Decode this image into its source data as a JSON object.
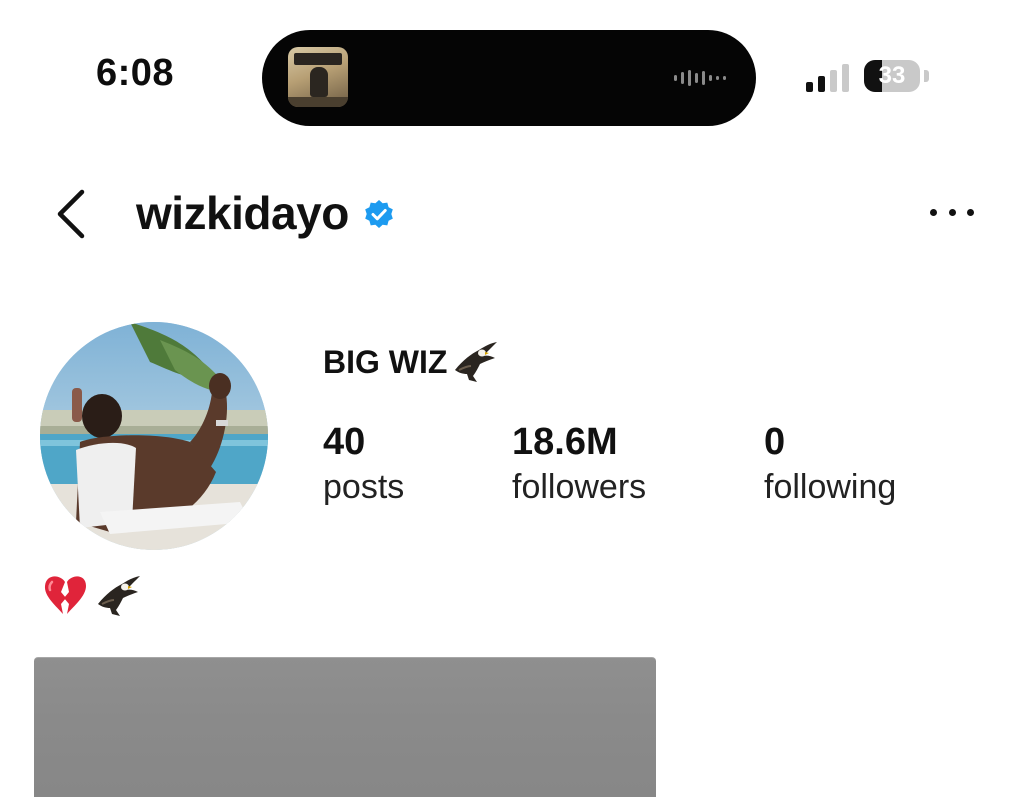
{
  "status_bar": {
    "time": "6:08",
    "battery_level": "33",
    "signal_bars_filled": 2,
    "signal_bars_total": 4
  },
  "now_playing": {
    "art_icon": "album-art-thumbnail",
    "wave_icon": "audio-waveform-icon"
  },
  "header": {
    "username": "wizkidayo",
    "verified": true,
    "back_icon": "chevron-left-icon",
    "more_icon": "more-horizontal-icon"
  },
  "profile": {
    "display_name": "BIG WIZ",
    "display_name_emoji": "eagle-icon",
    "stats": [
      {
        "value": "40",
        "label": "posts"
      },
      {
        "value": "18.6M",
        "label": "followers"
      },
      {
        "value": "0",
        "label": "following"
      }
    ],
    "bio_emojis": [
      "broken-heart-icon",
      "eagle-icon"
    ]
  },
  "colors": {
    "verified_blue": "#1d9bf0",
    "text": "#111111",
    "card_gray": "#8a8a8a",
    "broken_heart_red": "#e0243a"
  }
}
